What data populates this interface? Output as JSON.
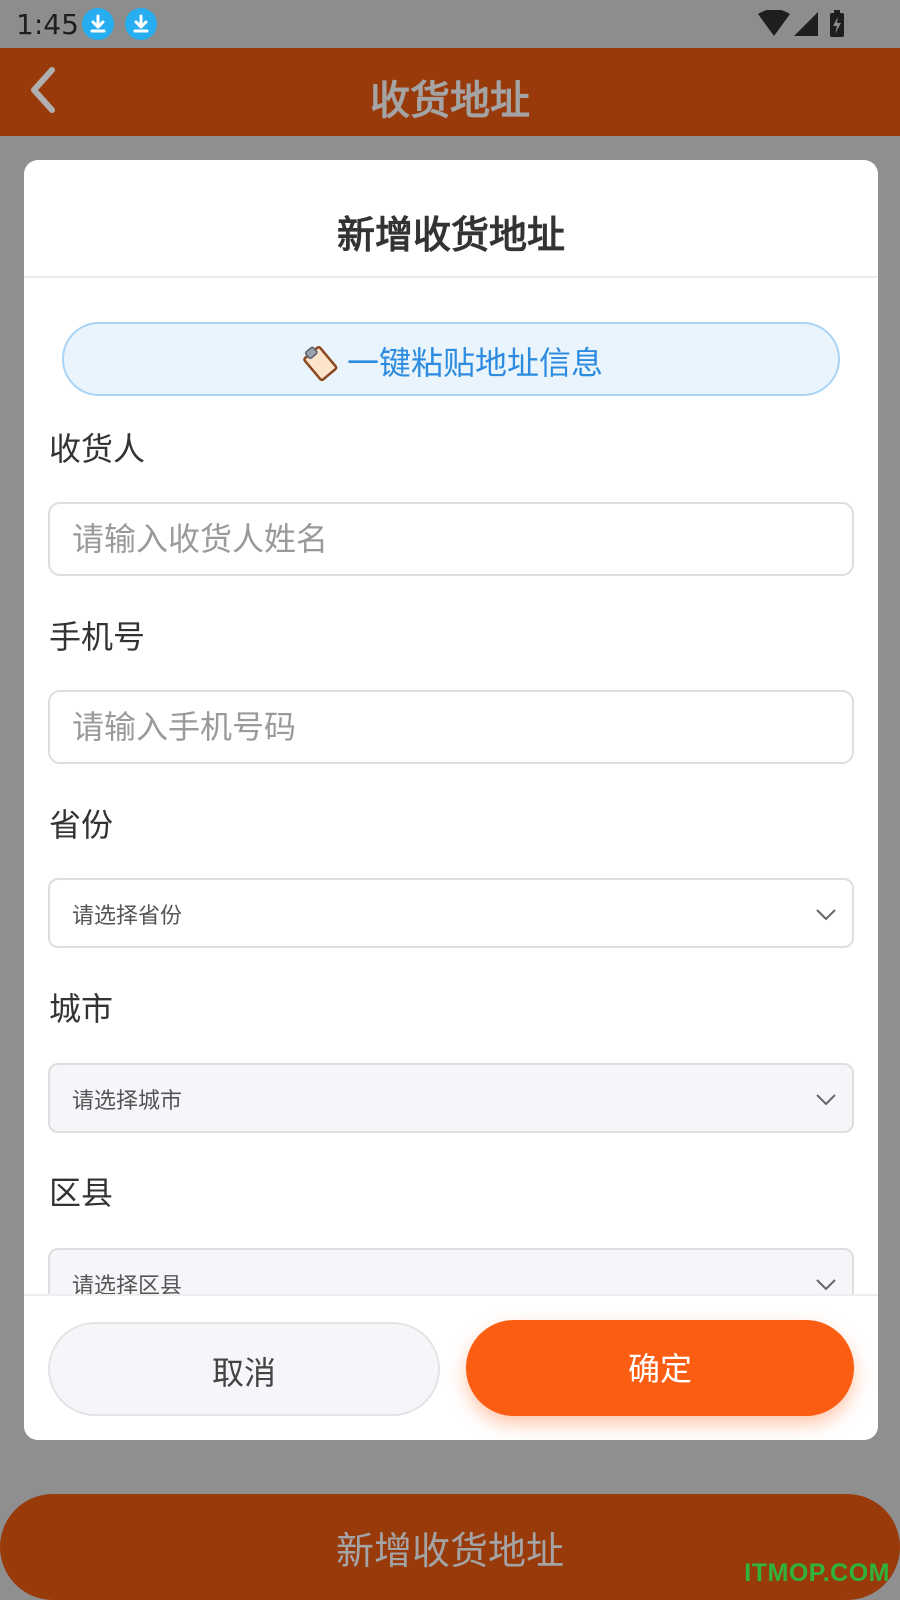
{
  "status_bar": {
    "time": "1:45",
    "icons": [
      "download-icon",
      "download-icon",
      "wifi-icon",
      "signal-icon",
      "battery-charging-icon"
    ]
  },
  "header": {
    "title": "收货地址",
    "back_icon": "chevron-left-icon"
  },
  "modal": {
    "title": "新增收货地址",
    "paste_button": {
      "label": "一键粘贴地址信息",
      "icon": "clipboard-icon"
    },
    "fields": {
      "recipient": {
        "label": "收货人",
        "value": "",
        "placeholder": "请输入收货人姓名"
      },
      "phone": {
        "label": "手机号",
        "value": "",
        "placeholder": "请输入手机号码"
      },
      "province": {
        "label": "省份",
        "selected": "请选择省份"
      },
      "city": {
        "label": "城市",
        "selected": "请选择城市"
      },
      "district": {
        "label": "区县",
        "selected": "请选择区县"
      }
    },
    "cancel_label": "取消",
    "confirm_label": "确定"
  },
  "bottom_button": {
    "label": "新增收货地址"
  },
  "watermark": "ITMOP.COM",
  "colors": {
    "header_bg": "#993a0b",
    "confirm_bg": "#fb5e12",
    "paste_text": "#2d8be0",
    "paste_bg": "#e9f4fd",
    "watermark": "#2fb33a"
  }
}
